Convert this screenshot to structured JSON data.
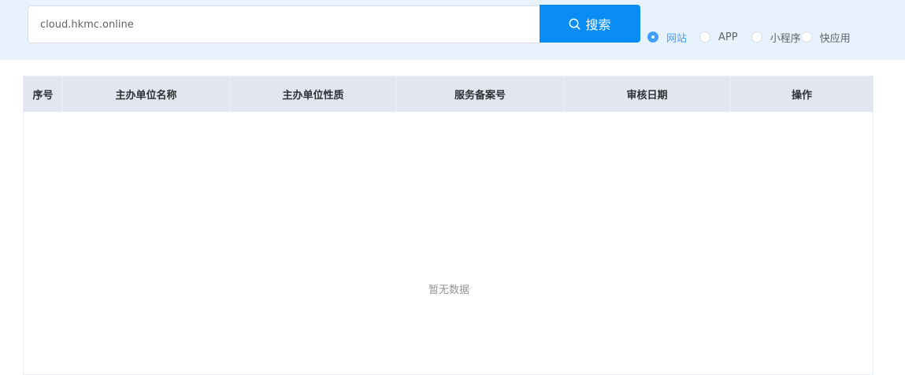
{
  "search": {
    "value": "cloud.hkmc.online",
    "button_label": "搜索"
  },
  "filters": [
    {
      "label": "网站",
      "checked": true
    },
    {
      "label": "APP",
      "checked": false
    },
    {
      "label": "小程序",
      "checked": false
    },
    {
      "label": "快应用",
      "checked": false
    }
  ],
  "table": {
    "columns": [
      "序号",
      "主办单位名称",
      "主办单位性质",
      "服务备案号",
      "审核日期",
      "操作"
    ],
    "empty_text": "暂无数据"
  },
  "colors": {
    "accent": "#409eff",
    "button": "#0a8cf5",
    "header_bg": "#e8f2fd",
    "table_header_bg": "#e1e6f0"
  }
}
